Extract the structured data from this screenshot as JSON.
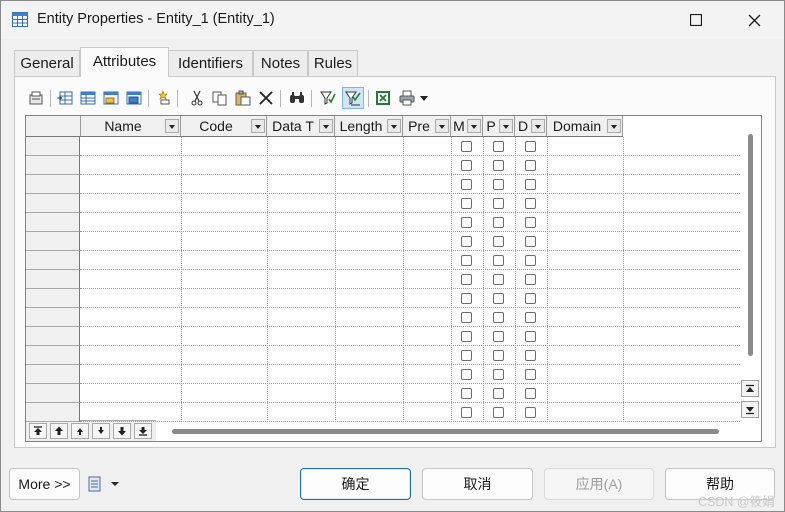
{
  "window": {
    "title": "Entity Properties - Entity_1 (Entity_1)"
  },
  "tabs": [
    {
      "label": "General"
    },
    {
      "label": "Attributes"
    },
    {
      "label": "Identifiers"
    },
    {
      "label": "Notes"
    },
    {
      "label": "Rules"
    }
  ],
  "active_tab": "Attributes",
  "toolbar": {
    "icons": [
      "properties-icon",
      "insert-row-icon",
      "add-row-icon",
      "add-attributes-icon",
      "replace-attributes-icon",
      "new-attribute-icon",
      "cut-icon",
      "copy-icon",
      "paste-icon",
      "delete-icon",
      "find-icon",
      "filter-icon",
      "customize-columns-icon",
      "excel-export-icon",
      "print-icon",
      "dropdown-arrow-icon"
    ],
    "active_icon": "customize-columns-icon"
  },
  "grid": {
    "columns": [
      {
        "label": "Name"
      },
      {
        "label": "Code"
      },
      {
        "label": "Data T"
      },
      {
        "label": "Length"
      },
      {
        "label": "Pre"
      },
      {
        "label": "M"
      },
      {
        "label": "P"
      },
      {
        "label": "D"
      },
      {
        "label": "Domain"
      }
    ],
    "row_count": 15,
    "checkbox_columns": [
      "M",
      "P",
      "D"
    ]
  },
  "bottom": {
    "more_label": "More >>",
    "ok_label": "确定",
    "cancel_label": "取消",
    "apply_label": "应用(A)",
    "help_label": "帮助"
  },
  "watermark": "CSDN @筱娟"
}
